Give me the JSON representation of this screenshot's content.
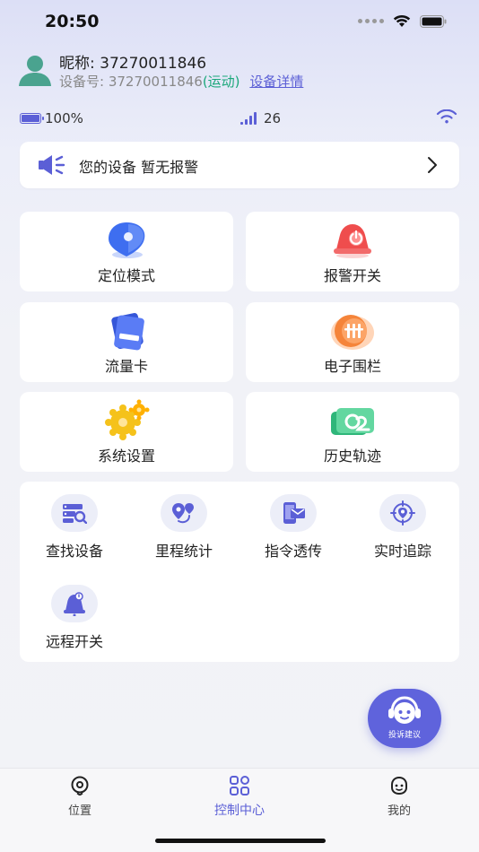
{
  "status_bar": {
    "time": "20:50"
  },
  "profile": {
    "nickname_label": "昵称:",
    "nickname_value": "37270011846",
    "device_label": "设备号:",
    "device_value": "37270011846",
    "mode": "(运动)",
    "detail_link": "设备详情"
  },
  "meta": {
    "battery": "100%",
    "signal": "26"
  },
  "alarm": {
    "text": "您的设备 暂无报警"
  },
  "feature_cards": [
    {
      "label": "定位模式",
      "icon": "location-pin-icon"
    },
    {
      "label": "报警开关",
      "icon": "alarm-bell-icon"
    },
    {
      "label": "流量卡",
      "icon": "sim-card-icon"
    },
    {
      "label": "电子围栏",
      "icon": "fence-icon"
    },
    {
      "label": "系统设置",
      "icon": "gear-icon"
    },
    {
      "label": "历史轨迹",
      "icon": "history-track-icon"
    }
  ],
  "tools": [
    {
      "label": "查找设备",
      "icon": "find-device-icon"
    },
    {
      "label": "里程统计",
      "icon": "mileage-icon"
    },
    {
      "label": "指令透传",
      "icon": "command-icon"
    },
    {
      "label": "实时追踪",
      "icon": "tracking-icon"
    },
    {
      "label": "远程开关",
      "icon": "remote-switch-icon"
    }
  ],
  "float_button": {
    "label": "投诉建议"
  },
  "tabbar": [
    {
      "label": "位置",
      "icon": "location-icon"
    },
    {
      "label": "控制中心",
      "icon": "control-grid-icon"
    },
    {
      "label": "我的",
      "icon": "profile-face-icon"
    }
  ],
  "colors": {
    "accent": "#5b5fd6",
    "mode_green": "#1aa77a"
  }
}
